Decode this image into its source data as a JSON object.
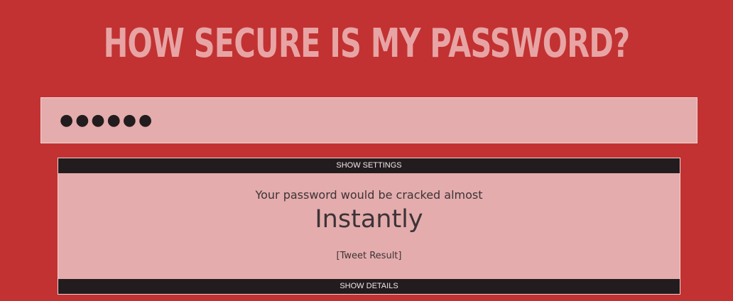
{
  "header": {
    "title": "HOW SECURE IS MY PASSWORD?"
  },
  "password": {
    "value": "●●●●●●"
  },
  "settings": {
    "label": "SHOW SETTINGS"
  },
  "result": {
    "intro": "Your password would be cracked almost",
    "time": "Instantly",
    "tweet_label": "[Tweet Result]"
  },
  "details": {
    "label": "SHOW DETAILS"
  },
  "colors": {
    "background": "#c23232",
    "title": "#e8a4a4",
    "panel": "#e4acac",
    "bar": "#231c1e"
  }
}
